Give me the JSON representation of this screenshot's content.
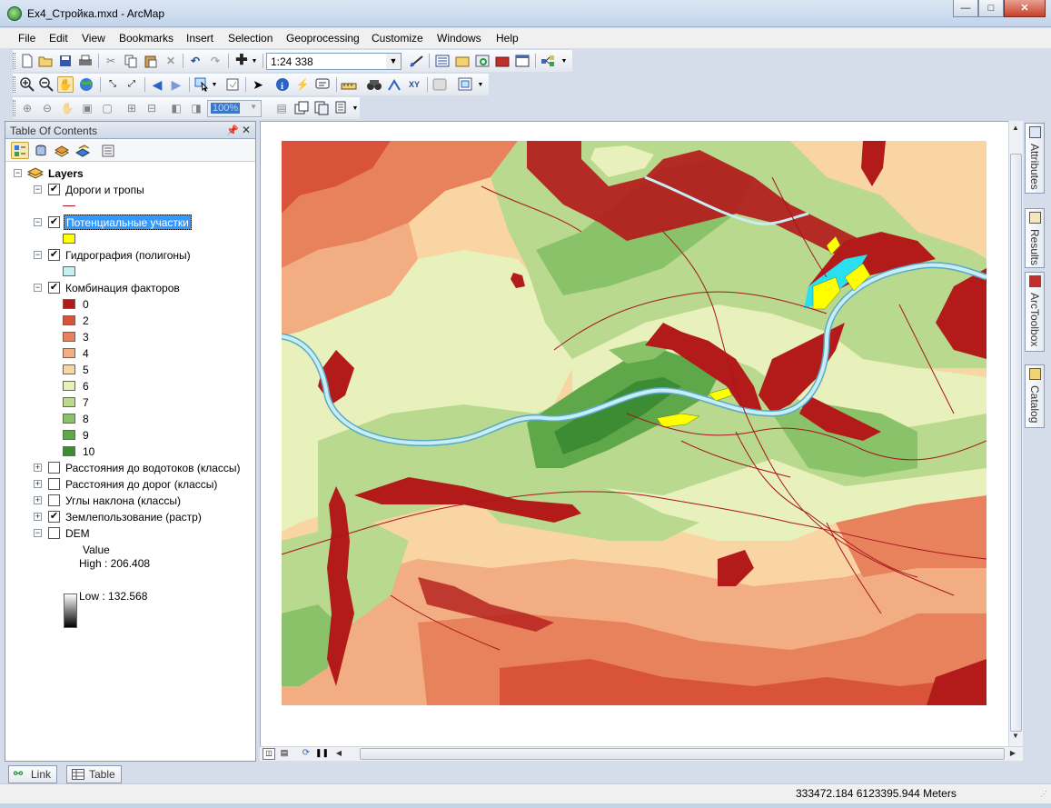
{
  "window": {
    "title": "Ex4_Стройка.mxd - ArcMap",
    "min": "—",
    "max": "□",
    "close": "✕"
  },
  "menu": [
    "File",
    "Edit",
    "View",
    "Bookmarks",
    "Insert",
    "Selection",
    "Geoprocessing",
    "Customize",
    "Windows",
    "Help"
  ],
  "toolbar": {
    "scale": "1:24 338",
    "zoom_percent": "100%"
  },
  "toc": {
    "title": "Table Of Contents",
    "pin": "ᵖ",
    "close": "✕",
    "root": "Layers",
    "layers": [
      {
        "name": "Дороги и тропы",
        "checked": true,
        "expanded": true
      },
      {
        "name": "Потенциальные участки",
        "checked": true,
        "expanded": true,
        "selected": true
      },
      {
        "name": "Гидрография (полигоны)",
        "checked": true,
        "expanded": true
      },
      {
        "name": "Комбинация факторов",
        "checked": true,
        "expanded": true
      },
      {
        "name": "Расстояния до водотоков (классы)",
        "checked": false,
        "expanded": false
      },
      {
        "name": "Расстояния до дорог (классы)",
        "checked": false,
        "expanded": false
      },
      {
        "name": "Углы наклона (классы)",
        "checked": false,
        "expanded": false
      },
      {
        "name": "Землепользование (растр)",
        "checked": true,
        "expanded": false
      },
      {
        "name": "DEM",
        "checked": false,
        "expanded": true
      }
    ],
    "legend_classes": [
      {
        "label": "0",
        "color": "#b31b1b"
      },
      {
        "label": "2",
        "color": "#d9533b"
      },
      {
        "label": "3",
        "color": "#e8825d"
      },
      {
        "label": "4",
        "color": "#f2ad82"
      },
      {
        "label": "5",
        "color": "#f9d5a4"
      },
      {
        "label": "6",
        "color": "#e8f0bb"
      },
      {
        "label": "7",
        "color": "#b8d98e"
      },
      {
        "label": "8",
        "color": "#8ac26a"
      },
      {
        "label": "9",
        "color": "#5fa84a"
      },
      {
        "label": "10",
        "color": "#3b8c33"
      }
    ],
    "dem": {
      "value_label": "Value",
      "high": "High : 206.408",
      "low": "Low : 132.568"
    }
  },
  "bottom_tabs": {
    "link": "Link",
    "table": "Table"
  },
  "dock_tabs": [
    "Attributes",
    "Results",
    "ArcToolbox",
    "Catalog"
  ],
  "status": {
    "coordinates": "333472.184  6123395.944 Meters"
  },
  "colors": {
    "road": "#a8141e",
    "potential": "#ffff00",
    "water": "#c8eef5",
    "water_edge": "#5aa9c4",
    "selection_highlight": "#3399ff"
  }
}
